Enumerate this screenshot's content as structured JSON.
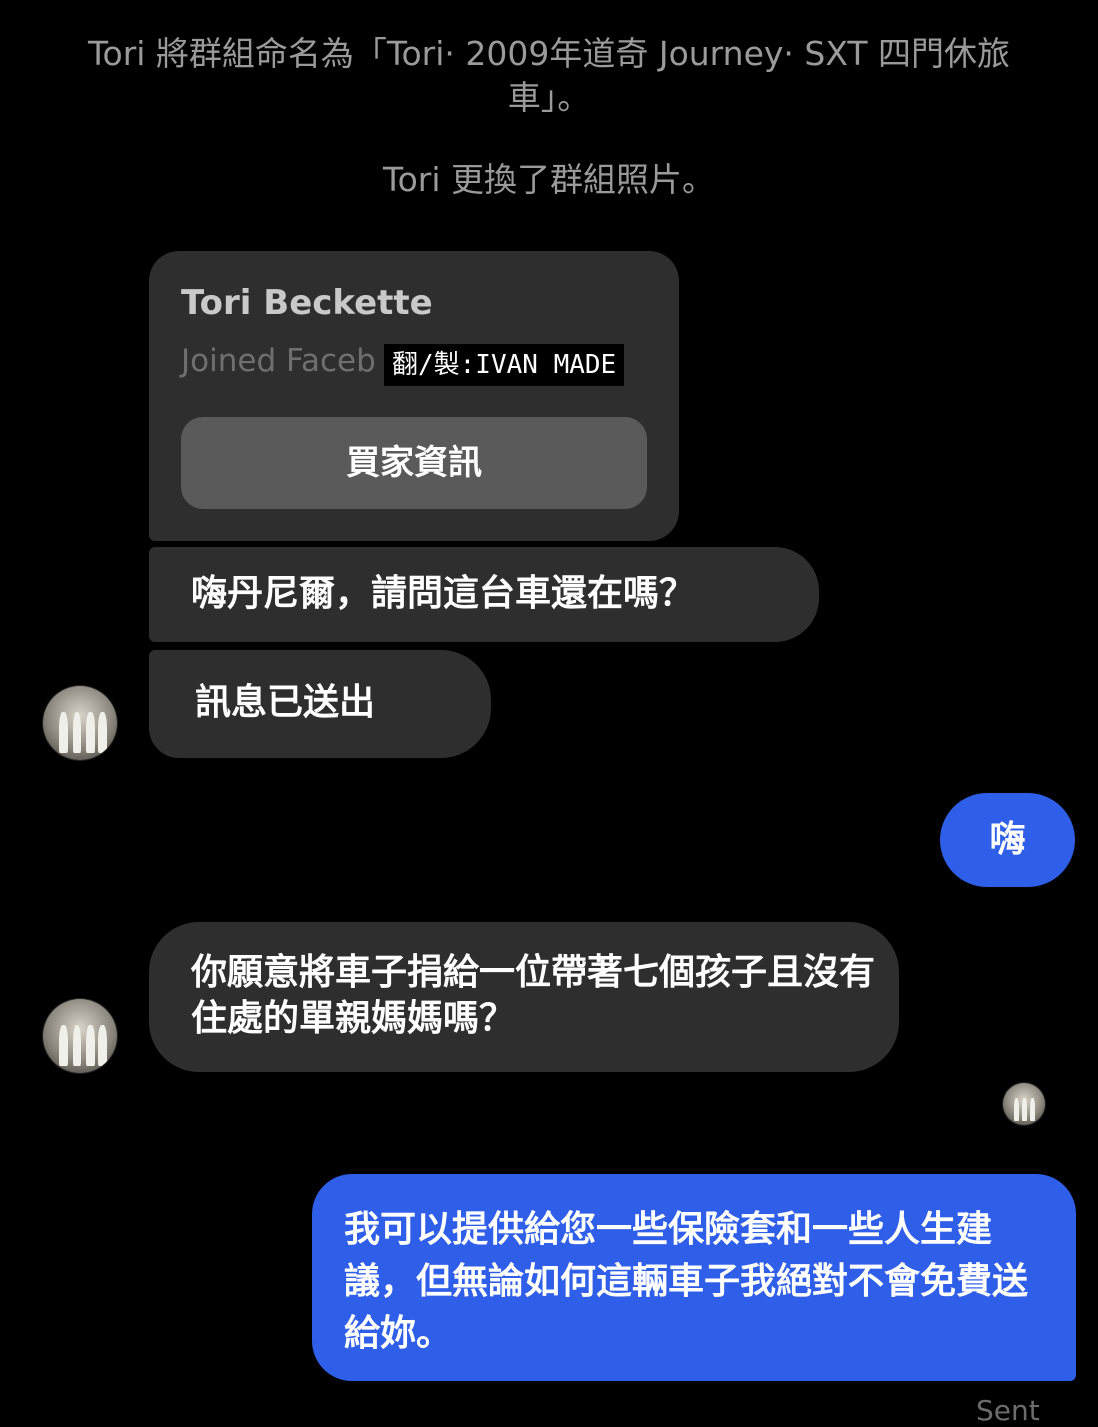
{
  "system_messages": {
    "rename": "Tori 將群組命名為「Tori· 2009年道奇 Journey· SXT 四門休旅車」。",
    "photo_change": "Tori 更換了群組照片。"
  },
  "profile_card": {
    "name": "Tori Beckette",
    "subtitle": "Joined Faceb",
    "watermark": "翻/製:IVAN MADE",
    "button_label": "買家資訊"
  },
  "messages": [
    {
      "side": "incoming",
      "text": "嗨丹尼爾，請問這台車還在嗎？"
    },
    {
      "side": "incoming",
      "text": "訊息已送出"
    },
    {
      "side": "outgoing",
      "text": "嗨"
    },
    {
      "side": "incoming",
      "text": "你願意將車子捐給一位帶著七個孩子且沒有住處的單親媽媽嗎？"
    },
    {
      "side": "outgoing",
      "text": "我可以提供給您一些保險套和一些人生建議，但無論如何這輛車子我絕對不會免費送給妳。"
    }
  ],
  "status": {
    "sent_label": "Sent"
  },
  "colors": {
    "background": "#000000",
    "incoming_bubble": "#2e2e2f",
    "outgoing_bubble": "#2f5fe8",
    "system_text": "#9a9a9a"
  }
}
